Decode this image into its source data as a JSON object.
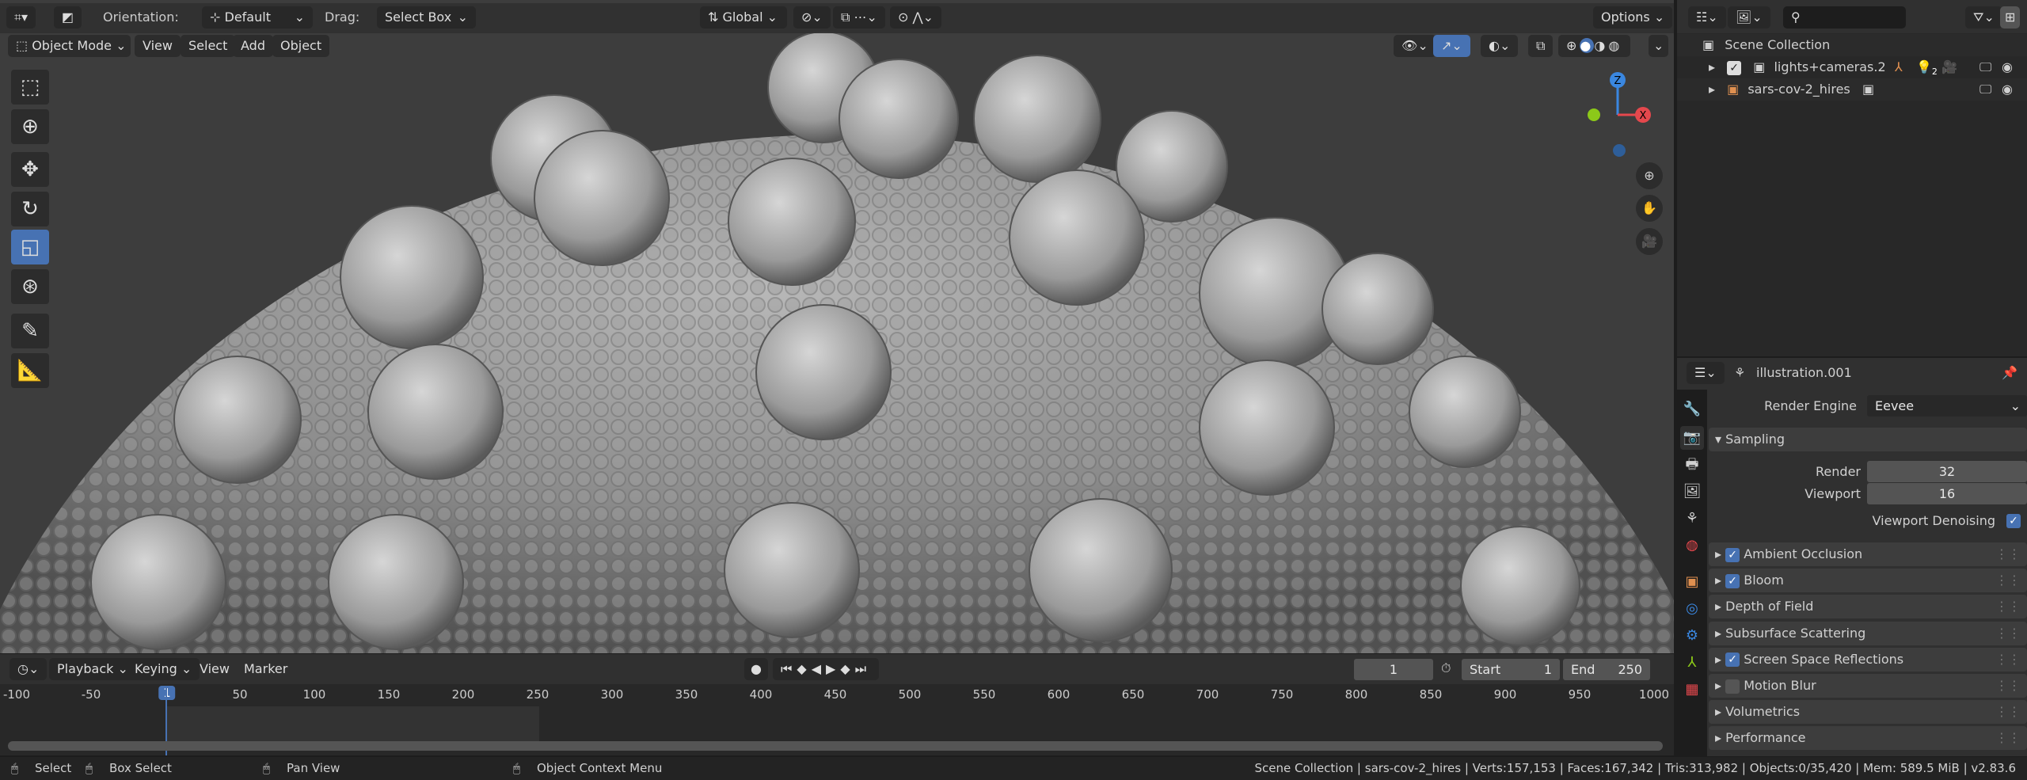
{
  "header": {
    "orientation_label": "Orientation:",
    "orientation_value": "Default",
    "drag_label": "Drag:",
    "drag_value": "Select Box",
    "transform_space": "Global",
    "options": "Options"
  },
  "viewport_menu": {
    "mode": "Object Mode",
    "items": [
      "View",
      "Select",
      "Add",
      "Object"
    ]
  },
  "gizmo": {
    "z": "Z",
    "x": "X"
  },
  "tools": [
    "select-box",
    "cursor",
    "move",
    "rotate",
    "scale",
    "transform",
    "annotate",
    "measure"
  ],
  "outliner": {
    "search_placeholder": "",
    "root": "Scene Collection",
    "items": [
      {
        "name": "lights+cameras.2",
        "checked": true,
        "light_count": "2"
      },
      {
        "name": "sars-cov-2_hires"
      }
    ]
  },
  "properties": {
    "title": "illustration.001",
    "render_engine_label": "Render Engine",
    "render_engine": "Eevee",
    "sampling": {
      "label": "Sampling",
      "render_label": "Render",
      "render": "32",
      "viewport_label": "Viewport",
      "viewport": "16",
      "denoise_label": "Viewport Denoising",
      "denoise": true
    },
    "panels": [
      {
        "label": "Ambient Occlusion",
        "checkbox": true,
        "checked": true
      },
      {
        "label": "Bloom",
        "checkbox": true,
        "checked": true
      },
      {
        "label": "Depth of Field",
        "checkbox": false
      },
      {
        "label": "Subsurface Scattering",
        "checkbox": false
      },
      {
        "label": "Screen Space Reflections",
        "checkbox": true,
        "checked": true
      },
      {
        "label": "Motion Blur",
        "checkbox": true,
        "checked": false
      },
      {
        "label": "Volumetrics",
        "checkbox": false
      },
      {
        "label": "Performance",
        "checkbox": false
      }
    ]
  },
  "timeline": {
    "menus": [
      "Playback",
      "Keying",
      "View",
      "Marker"
    ],
    "current_frame": "1",
    "start_label": "Start",
    "start": "1",
    "end_label": "End",
    "end": "250",
    "ticks": [
      "-100",
      "-50",
      "1",
      "50",
      "100",
      "150",
      "200",
      "250",
      "300",
      "350",
      "400",
      "450",
      "500",
      "550",
      "600",
      "650",
      "700",
      "750",
      "800",
      "850",
      "900",
      "950",
      "1000"
    ]
  },
  "status": {
    "select": "Select",
    "box_select": "Box Select",
    "pan_view": "Pan View",
    "context_menu": "Object Context Menu",
    "info": "Scene Collection | sars-cov-2_hires | Verts:157,153 | Faces:167,342 | Tris:313,982 | Objects:0/35,420 | Mem: 589.5 MiB | v2.83.6"
  },
  "colors": {
    "accent": "#4772b3",
    "orange": "#e09050",
    "gizmo_x": "#e5484d",
    "gizmo_y": "#8cc919",
    "gizmo_z": "#3a87e0"
  }
}
